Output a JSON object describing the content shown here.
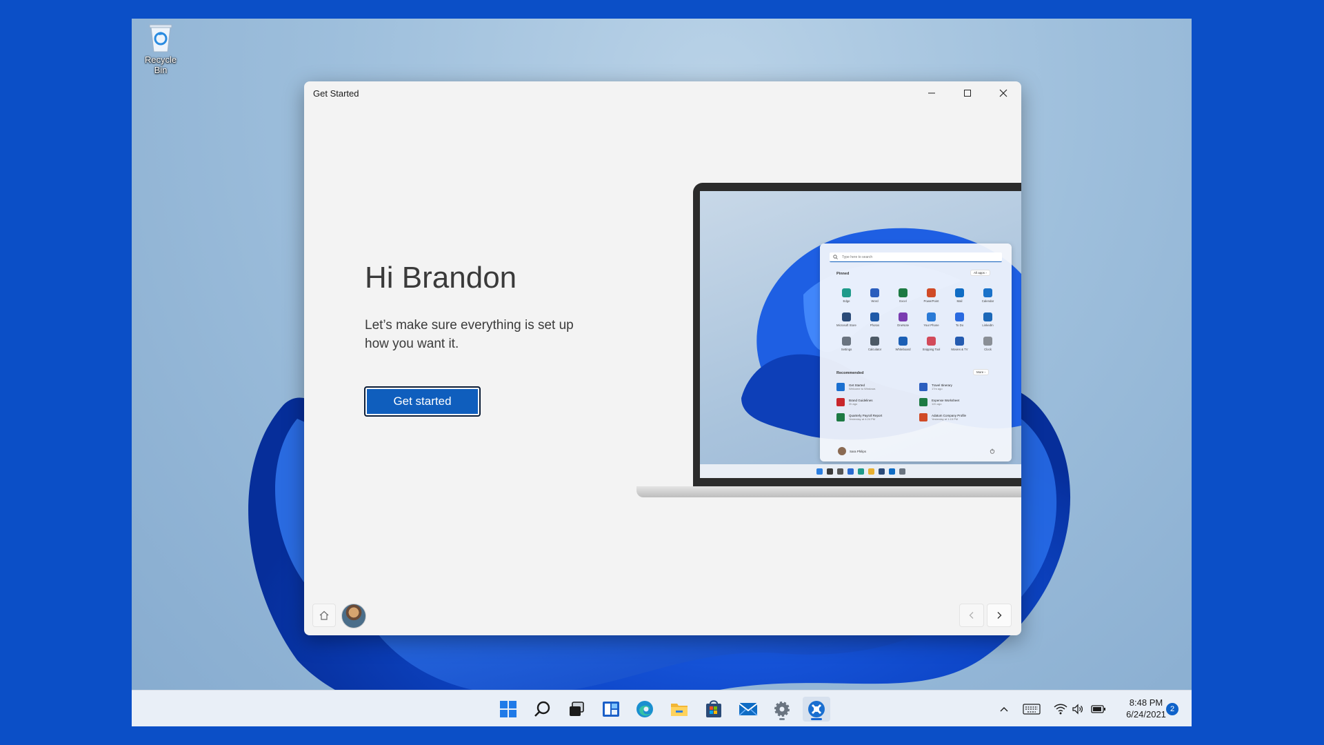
{
  "desktop": {
    "recycle_bin_label": "Recycle Bin"
  },
  "window": {
    "title": "Get Started",
    "heading": "Hi Brandon",
    "body": "Let’s make sure everything is set up how you want it.",
    "cta_label": "Get started"
  },
  "laptop_preview": {
    "search_placeholder": "Type here to search",
    "pinned_label": "Pinned",
    "all_apps_label": "All apps  ›",
    "recommended_label": "Recommended",
    "more_label": "More  ›",
    "apps": [
      {
        "name": "Edge",
        "color": "#1f9a8a"
      },
      {
        "name": "Word",
        "color": "#2b5ebe"
      },
      {
        "name": "Excel",
        "color": "#1d7a43"
      },
      {
        "name": "PowerPoint",
        "color": "#d04a26"
      },
      {
        "name": "Mail",
        "color": "#0f6cc4"
      },
      {
        "name": "Calendar",
        "color": "#1a72c9"
      },
      {
        "name": "Microsoft Store",
        "color": "#2a4a78"
      },
      {
        "name": "Photos",
        "color": "#1f5aa8"
      },
      {
        "name": "OneNote",
        "color": "#7a3cb0"
      },
      {
        "name": "Your Phone",
        "color": "#2a7ad6"
      },
      {
        "name": "To Do",
        "color": "#2a6ae0"
      },
      {
        "name": "LinkedIn",
        "color": "#1c68b8"
      },
      {
        "name": "Settings",
        "color": "#6a7480"
      },
      {
        "name": "Calculator",
        "color": "#4d5a66"
      },
      {
        "name": "Whiteboard",
        "color": "#1b5fb5"
      },
      {
        "name": "Snipping Tool",
        "color": "#d24a5a"
      },
      {
        "name": "Movies & TV",
        "color": "#245bb0"
      },
      {
        "name": "Clock",
        "color": "#8a8f96"
      }
    ],
    "recommended": [
      {
        "title": "Get Started",
        "sub": "Welcome to Windows",
        "color": "#1a6fd0"
      },
      {
        "title": "Travel Itinerary",
        "sub": "17m ago",
        "color": "#2b5ebe"
      },
      {
        "title": "Brand Guidelines",
        "sub": "2h ago",
        "color": "#c8262b"
      },
      {
        "title": "Expense Worksheet",
        "sub": "12h ago",
        "color": "#1d7a43"
      },
      {
        "title": "Quarterly Payroll Report",
        "sub": "Yesterday at 4:24 PM",
        "color": "#1d7a43"
      },
      {
        "title": "Adatum Company Profile",
        "sub": "Yesterday at 1:15 PM",
        "color": "#d04a26"
      }
    ],
    "user_name": "Sara Philips"
  },
  "taskbar": {
    "apps": [
      {
        "name": "Start",
        "active": false
      },
      {
        "name": "Search",
        "active": false
      },
      {
        "name": "Task View",
        "active": false
      },
      {
        "name": "Widgets",
        "active": false
      },
      {
        "name": "Microsoft Edge",
        "active": false
      },
      {
        "name": "File Explorer",
        "active": false
      },
      {
        "name": "Microsoft Store",
        "active": false
      },
      {
        "name": "Mail",
        "active": false
      },
      {
        "name": "Settings",
        "active": false
      },
      {
        "name": "Get Started",
        "active": true
      }
    ],
    "time": "8:48 PM",
    "date": "6/24/2021",
    "notification_count": "2"
  },
  "colors": {
    "accent": "#0f5ebd",
    "outer_background": "#0b4fc7"
  }
}
